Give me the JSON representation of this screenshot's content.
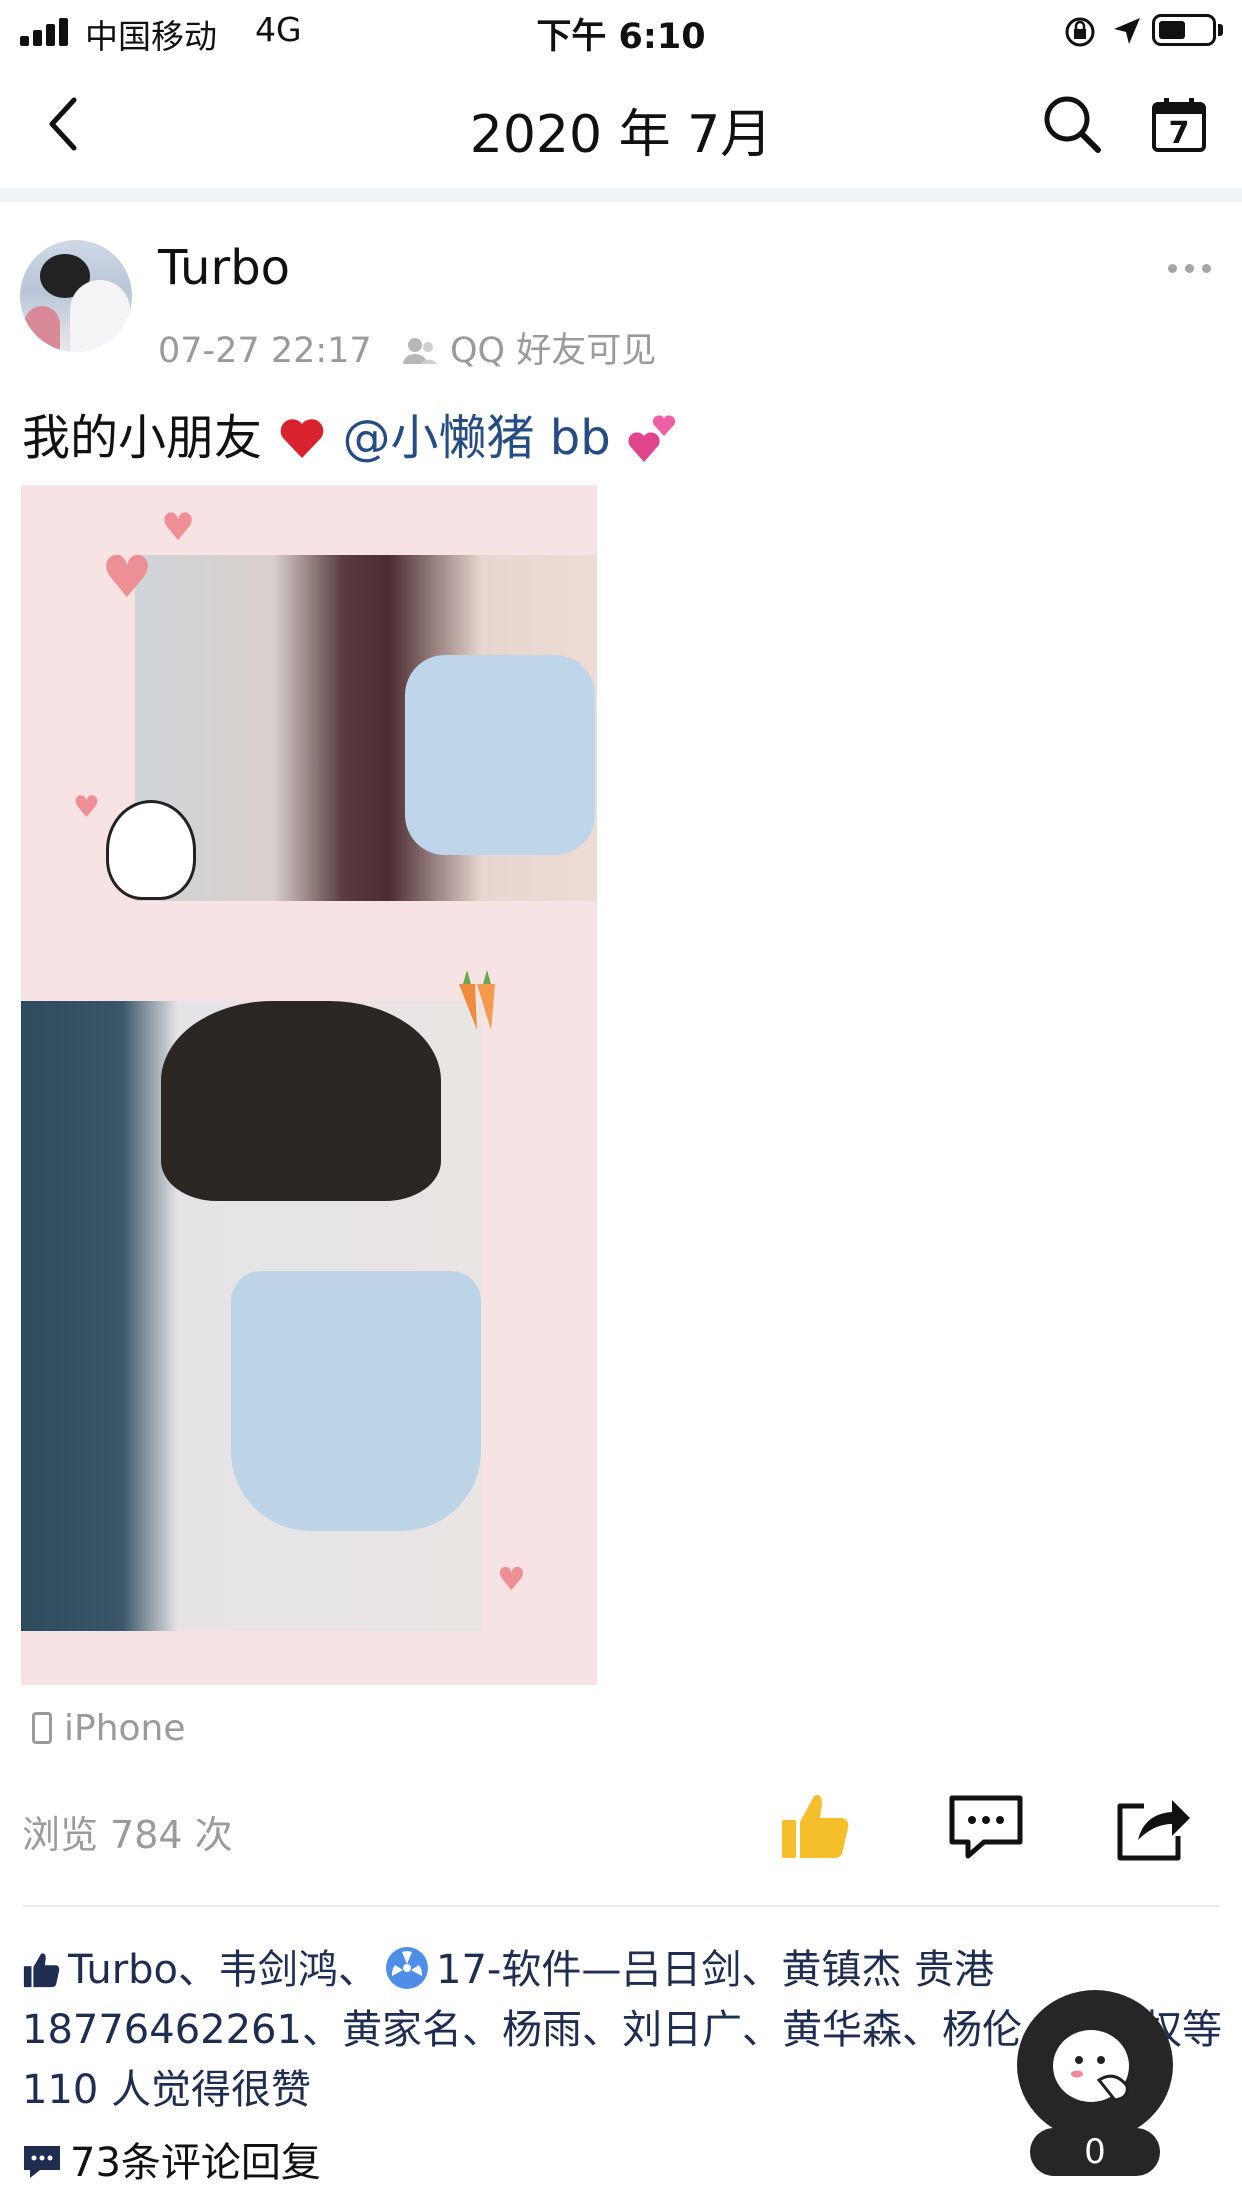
{
  "status_bar": {
    "carrier": "中国移动",
    "network": "4G",
    "time": "下午 6:10"
  },
  "nav": {
    "title": "2020 年 7月",
    "calendar_day": "7"
  },
  "post": {
    "author": "Turbo",
    "timestamp": "07-27 22:17",
    "visibility": "QQ 好友可见",
    "text_main": "我的小朋友",
    "mention": "@小懒猪 bb",
    "device": "iPhone",
    "views": "浏览 784 次",
    "likes_line": "Turbo、韦剑鸿、",
    "likes_rest": "17-软件—吕日剑、黄镇杰 贵港 18776462261、黄家名、杨雨、刘日广、黄华森、杨伦、黎国权等 110 人觉得很赞",
    "comments": "73条评论回复"
  },
  "float_button": {
    "count": "0"
  },
  "colors": {
    "mention": "#264c86",
    "like_active": "#f5bf2c",
    "muted": "#9a9a9a"
  }
}
